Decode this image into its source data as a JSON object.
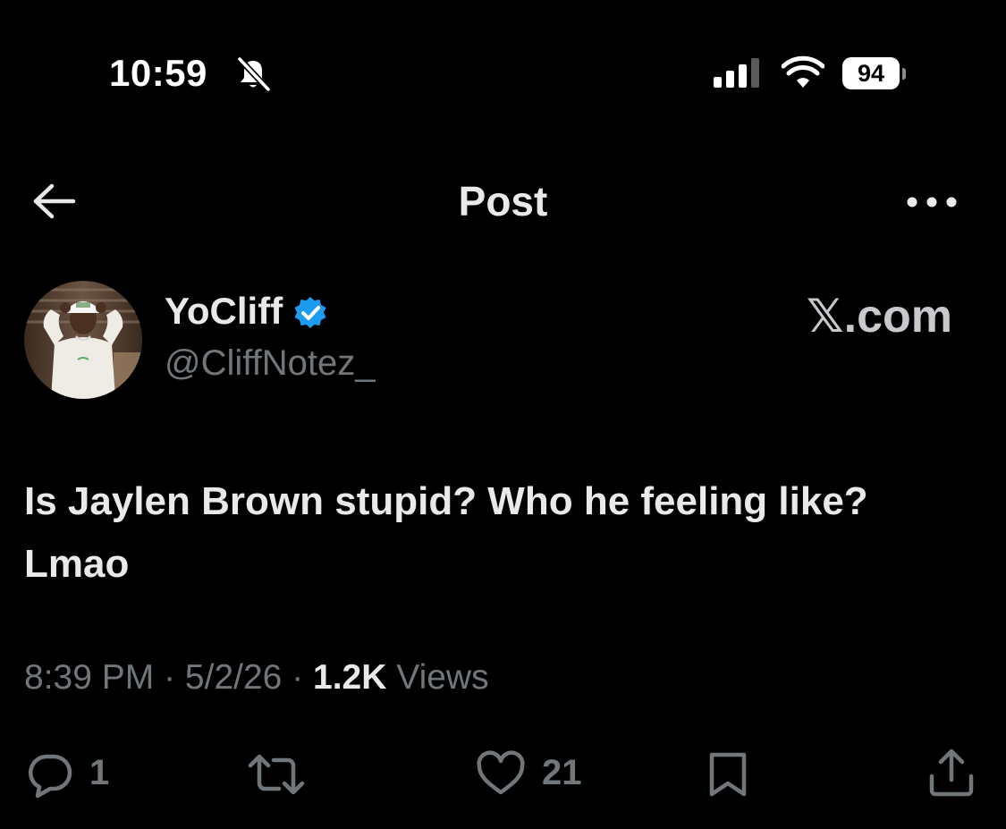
{
  "status_bar": {
    "time": "10:59",
    "battery": "94",
    "silent_icon": "bell-slash-icon",
    "signal_icon": "cellular-signal-icon",
    "wifi_icon": "wifi-icon"
  },
  "header": {
    "title": "Post",
    "back_icon": "arrow-left-icon",
    "more_icon": "more-horizontal-icon"
  },
  "author": {
    "display_name": "YoCliff",
    "handle": "@CliffNotez_",
    "verified": true,
    "verified_color": "#1d9bf0"
  },
  "branding": {
    "label": "𝕏.com"
  },
  "tweet": {
    "text": "Is Jaylen Brown stupid? Who he feeling like? Lmao"
  },
  "meta": {
    "time": "8:39 PM",
    "separator": " · ",
    "date": "5/2/26",
    "views_count": "1.2K",
    "views_label": "Views"
  },
  "actions": {
    "reply_count": "1",
    "like_count": "21",
    "icons": [
      "reply-icon",
      "retweet-icon",
      "like-icon",
      "bookmark-icon",
      "share-icon"
    ]
  },
  "colors": {
    "background": "#000000",
    "primary_text": "#e7e9ea",
    "secondary_text": "#71767b",
    "verified_blue": "#1d9bf0"
  }
}
